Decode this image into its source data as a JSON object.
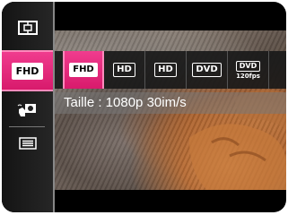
{
  "sidebar": {
    "items": [
      {
        "name": "scene-mode",
        "icon": "scene-frame-icon"
      },
      {
        "name": "video-size",
        "icon": "fhd-icon",
        "label": "FHD",
        "selected": true
      },
      {
        "name": "stabilization",
        "icon": "stabilizer-hand-icon"
      },
      {
        "name": "menu",
        "icon": "menu-list-icon"
      }
    ]
  },
  "options": [
    {
      "label": "FHD",
      "selected": true
    },
    {
      "label": "HD"
    },
    {
      "label": "HD"
    },
    {
      "label": "DVD"
    },
    {
      "label": "DVD",
      "sub": "120fps"
    }
  ],
  "caption": {
    "text": "Taille : 1080p 30im/s"
  },
  "colors": {
    "accent": "#e8287c",
    "background": "#000000"
  }
}
